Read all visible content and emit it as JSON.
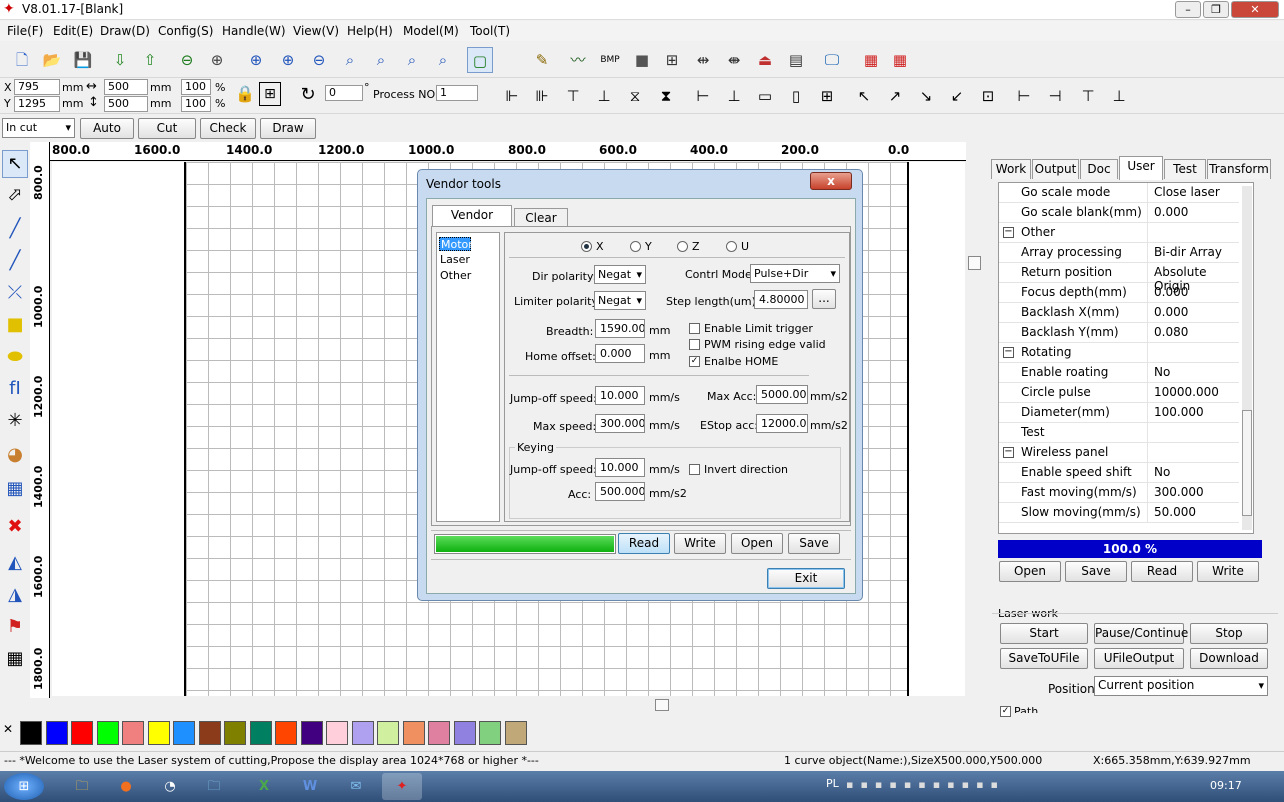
{
  "app": {
    "title": "V8.01.17-[Blank]"
  },
  "menu": [
    "File(F)",
    "Edit(E)",
    "Draw(D)",
    "Config(S)",
    "Handle(W)",
    "View(V)",
    "Help(H)",
    "Model(M)",
    "Tool(T)"
  ],
  "coords": {
    "x_label": "X",
    "x_value": "795",
    "y_label": "Y",
    "y_value": "1295",
    "unit": "mm",
    "w_value": "500",
    "h_value": "500",
    "pct_w": "100",
    "pct_h": "100",
    "pct_sign": "%",
    "angle": "0",
    "deg": "°",
    "process_label": "Process NO:",
    "process_value": "1"
  },
  "toolbar3": {
    "mode": "In cut",
    "auto": "Auto",
    "cutinout": "Cut In/Out",
    "check": "Check",
    "draw": "Draw"
  },
  "ruler_top": [
    "800.0",
    "1600.0",
    "1400.0",
    "1200.0",
    "1000.0",
    "800.0",
    "600.0",
    "400.0",
    "200.0",
    "0.0"
  ],
  "ruler_left": [
    "800.0",
    "1000.0",
    "1200.0",
    "1400.0",
    "1600.0",
    "1800.0"
  ],
  "palette": [
    "#000000",
    "#0000ff",
    "#ff0000",
    "#00ff00",
    "#f08080",
    "#ffff00",
    "#1e90ff",
    "#8b3a1a",
    "#808000",
    "#008060",
    "#ff4500",
    "#400080",
    "#ffd0dc",
    "#b0a0f0",
    "#d0f0a0",
    "#f09060",
    "#e080a0",
    "#9080e0",
    "#80d080",
    "#c0a878"
  ],
  "status": {
    "left": "--- *Welcome to use the Laser system of cutting,Propose the display area 1024*768 or higher *---",
    "mid": "1 curve object(Name:),SizeX500.000,Y500.000",
    "right": "X:665.358mm,Y:639.927mm"
  },
  "taskbar": {
    "lang": "PL",
    "time": "09:17"
  },
  "right_tabs": [
    "Work",
    "Output",
    "Doc",
    "User",
    "Test",
    "Transform"
  ],
  "props": [
    {
      "k": "Go scale mode",
      "v": "Close laser"
    },
    {
      "k": "Go scale blank(mm)",
      "v": "0.000"
    },
    {
      "k": "Other",
      "v": "",
      "group": true
    },
    {
      "k": "Array processing",
      "v": "Bi-dir Array"
    },
    {
      "k": "Return position",
      "v": "Absolute Origin"
    },
    {
      "k": "Focus depth(mm)",
      "v": "0.000"
    },
    {
      "k": "Backlash X(mm)",
      "v": "0.000"
    },
    {
      "k": "Backlash Y(mm)",
      "v": "0.080"
    },
    {
      "k": "Rotating",
      "v": "",
      "group": true
    },
    {
      "k": "Enable roating",
      "v": "No"
    },
    {
      "k": "Circle pulse",
      "v": "10000.000"
    },
    {
      "k": "Diameter(mm)",
      "v": "100.000"
    },
    {
      "k": "Test",
      "v": ""
    },
    {
      "k": "Wireless panel",
      "v": "",
      "group": true
    },
    {
      "k": "Enable speed shift",
      "v": "No"
    },
    {
      "k": "Fast moving(mm/s)",
      "v": "300.000"
    },
    {
      "k": "Slow moving(mm/s)",
      "v": "50.000"
    }
  ],
  "progress": {
    "text": "100.0  %",
    "value": 1.0
  },
  "right_buttons": {
    "open": "Open",
    "save": "Save",
    "read": "Read",
    "write": "Write"
  },
  "laserwork": {
    "title": "Laser work",
    "start": "Start",
    "pause": "Pause/Continue",
    "stop": "Stop",
    "savetou": "SaveToUFile",
    "ufile": "UFileOutput",
    "download": "Download",
    "pos_label": "Position:",
    "pos_value": "Current position",
    "path_opt": "Path optimize"
  },
  "dialog": {
    "title": "Vendor tools",
    "close": "x",
    "tabs": [
      "Vendor param",
      "Clear info"
    ],
    "categories": [
      "Motor",
      "Laser",
      "Other"
    ],
    "axes": [
      "X",
      "Y",
      "Z",
      "U"
    ],
    "dir_polarity_label": "Dir polarity:",
    "dir_polarity": "Negat",
    "limiter_label": "Limiter polarity:",
    "limiter": "Negat",
    "ctrl_mode_label": "Contrl Mode:",
    "ctrl_mode": "Pulse+Dir",
    "step_label": "Step length(um):",
    "step": "4.80000",
    "browse": "...",
    "breadth_label": "Breadth:",
    "breadth": "1590.000",
    "mm": "mm",
    "home_label": "Home offset:",
    "home": "0.000",
    "enable_limit": "Enable Limit trigger",
    "pwm_edge": "PWM rising edge valid",
    "enable_home": "Enalbe HOME",
    "jump_label": "Jump-off speed:",
    "jump": "10.000",
    "mms": "mm/s",
    "maxspeed_label": "Max speed:",
    "maxspeed": "300.000",
    "maxacc_label": "Max Acc:",
    "maxacc": "5000.000",
    "mms2": "mm/s2",
    "estop_label": "EStop acc:",
    "estop": "12000.00",
    "keying": "Keying",
    "key_jump": "10.000",
    "invert": "Invert direction",
    "acc_label": "Acc:",
    "acc": "500.000",
    "read": "Read",
    "write": "Write",
    "open": "Open",
    "save": "Save",
    "exit": "Exit"
  }
}
